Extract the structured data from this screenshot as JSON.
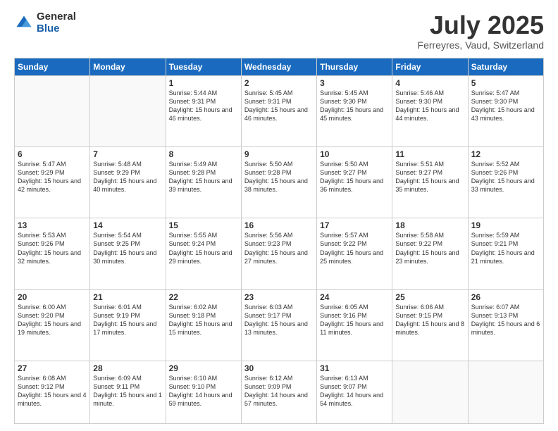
{
  "logo": {
    "general": "General",
    "blue": "Blue"
  },
  "header": {
    "title": "July 2025",
    "subtitle": "Ferreyres, Vaud, Switzerland"
  },
  "weekdays": [
    "Sunday",
    "Monday",
    "Tuesday",
    "Wednesday",
    "Thursday",
    "Friday",
    "Saturday"
  ],
  "weeks": [
    [
      {
        "day": "",
        "info": ""
      },
      {
        "day": "",
        "info": ""
      },
      {
        "day": "1",
        "info": "Sunrise: 5:44 AM\nSunset: 9:31 PM\nDaylight: 15 hours and 46 minutes."
      },
      {
        "day": "2",
        "info": "Sunrise: 5:45 AM\nSunset: 9:31 PM\nDaylight: 15 hours and 46 minutes."
      },
      {
        "day": "3",
        "info": "Sunrise: 5:45 AM\nSunset: 9:30 PM\nDaylight: 15 hours and 45 minutes."
      },
      {
        "day": "4",
        "info": "Sunrise: 5:46 AM\nSunset: 9:30 PM\nDaylight: 15 hours and 44 minutes."
      },
      {
        "day": "5",
        "info": "Sunrise: 5:47 AM\nSunset: 9:30 PM\nDaylight: 15 hours and 43 minutes."
      }
    ],
    [
      {
        "day": "6",
        "info": "Sunrise: 5:47 AM\nSunset: 9:29 PM\nDaylight: 15 hours and 42 minutes."
      },
      {
        "day": "7",
        "info": "Sunrise: 5:48 AM\nSunset: 9:29 PM\nDaylight: 15 hours and 40 minutes."
      },
      {
        "day": "8",
        "info": "Sunrise: 5:49 AM\nSunset: 9:28 PM\nDaylight: 15 hours and 39 minutes."
      },
      {
        "day": "9",
        "info": "Sunrise: 5:50 AM\nSunset: 9:28 PM\nDaylight: 15 hours and 38 minutes."
      },
      {
        "day": "10",
        "info": "Sunrise: 5:50 AM\nSunset: 9:27 PM\nDaylight: 15 hours and 36 minutes."
      },
      {
        "day": "11",
        "info": "Sunrise: 5:51 AM\nSunset: 9:27 PM\nDaylight: 15 hours and 35 minutes."
      },
      {
        "day": "12",
        "info": "Sunrise: 5:52 AM\nSunset: 9:26 PM\nDaylight: 15 hours and 33 minutes."
      }
    ],
    [
      {
        "day": "13",
        "info": "Sunrise: 5:53 AM\nSunset: 9:26 PM\nDaylight: 15 hours and 32 minutes."
      },
      {
        "day": "14",
        "info": "Sunrise: 5:54 AM\nSunset: 9:25 PM\nDaylight: 15 hours and 30 minutes."
      },
      {
        "day": "15",
        "info": "Sunrise: 5:55 AM\nSunset: 9:24 PM\nDaylight: 15 hours and 29 minutes."
      },
      {
        "day": "16",
        "info": "Sunrise: 5:56 AM\nSunset: 9:23 PM\nDaylight: 15 hours and 27 minutes."
      },
      {
        "day": "17",
        "info": "Sunrise: 5:57 AM\nSunset: 9:22 PM\nDaylight: 15 hours and 25 minutes."
      },
      {
        "day": "18",
        "info": "Sunrise: 5:58 AM\nSunset: 9:22 PM\nDaylight: 15 hours and 23 minutes."
      },
      {
        "day": "19",
        "info": "Sunrise: 5:59 AM\nSunset: 9:21 PM\nDaylight: 15 hours and 21 minutes."
      }
    ],
    [
      {
        "day": "20",
        "info": "Sunrise: 6:00 AM\nSunset: 9:20 PM\nDaylight: 15 hours and 19 minutes."
      },
      {
        "day": "21",
        "info": "Sunrise: 6:01 AM\nSunset: 9:19 PM\nDaylight: 15 hours and 17 minutes."
      },
      {
        "day": "22",
        "info": "Sunrise: 6:02 AM\nSunset: 9:18 PM\nDaylight: 15 hours and 15 minutes."
      },
      {
        "day": "23",
        "info": "Sunrise: 6:03 AM\nSunset: 9:17 PM\nDaylight: 15 hours and 13 minutes."
      },
      {
        "day": "24",
        "info": "Sunrise: 6:05 AM\nSunset: 9:16 PM\nDaylight: 15 hours and 11 minutes."
      },
      {
        "day": "25",
        "info": "Sunrise: 6:06 AM\nSunset: 9:15 PM\nDaylight: 15 hours and 8 minutes."
      },
      {
        "day": "26",
        "info": "Sunrise: 6:07 AM\nSunset: 9:13 PM\nDaylight: 15 hours and 6 minutes."
      }
    ],
    [
      {
        "day": "27",
        "info": "Sunrise: 6:08 AM\nSunset: 9:12 PM\nDaylight: 15 hours and 4 minutes."
      },
      {
        "day": "28",
        "info": "Sunrise: 6:09 AM\nSunset: 9:11 PM\nDaylight: 15 hours and 1 minute."
      },
      {
        "day": "29",
        "info": "Sunrise: 6:10 AM\nSunset: 9:10 PM\nDaylight: 14 hours and 59 minutes."
      },
      {
        "day": "30",
        "info": "Sunrise: 6:12 AM\nSunset: 9:09 PM\nDaylight: 14 hours and 57 minutes."
      },
      {
        "day": "31",
        "info": "Sunrise: 6:13 AM\nSunset: 9:07 PM\nDaylight: 14 hours and 54 minutes."
      },
      {
        "day": "",
        "info": ""
      },
      {
        "day": "",
        "info": ""
      }
    ]
  ]
}
